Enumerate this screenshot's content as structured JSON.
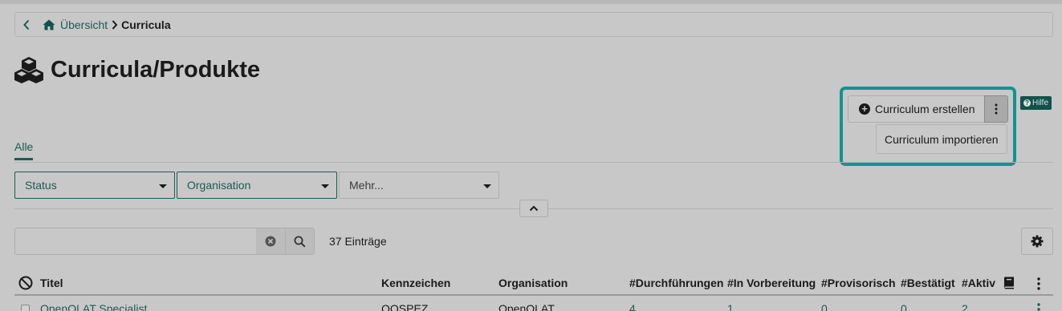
{
  "breadcrumb": {
    "home_label": "Übersicht",
    "current": "Curricula"
  },
  "page": {
    "title": "Curricula/Produkte"
  },
  "actions": {
    "create_label": "Curriculum erstellen",
    "menu_item_import": "Curriculum importieren",
    "help_label": "Hilfe"
  },
  "tabs": [
    {
      "label": "Alle",
      "active": true
    }
  ],
  "filters": [
    {
      "label": "Status",
      "active": true
    },
    {
      "label": "Organisation",
      "active": true
    },
    {
      "label": "Mehr...",
      "active": false
    }
  ],
  "search": {
    "placeholder": "",
    "value": ""
  },
  "results": {
    "count_label": "37 Einträge"
  },
  "table": {
    "columns": [
      "Titel",
      "Kennzeichen",
      "Organisation",
      "#Durchführungen",
      "#In Vorbereitung",
      "#Provisorisch",
      "#Bestätigt",
      "#Aktiv"
    ],
    "rows": [
      {
        "title": "OpenOLAT Specialist",
        "code": "OOSPEZ",
        "organisation": "OpenOLAT",
        "durchfuehrungen": "4",
        "vorbereitung": "1",
        "provisorisch": "0",
        "bestaetigt": "0",
        "aktiv": "2"
      }
    ]
  },
  "colors": {
    "accent": "#1d5a52",
    "highlight": "#0f9494",
    "background": "#c8c8c8"
  },
  "icons": {
    "back": "chevron-left-icon",
    "home": "home-icon",
    "separator": "chevron-right-icon",
    "title": "cubes-icon",
    "create": "plus-circle-icon",
    "more": "vertical-dots-icon",
    "help": "question-circle-icon",
    "clear": "clear-circle-icon",
    "search": "search-icon",
    "settings": "gear-icon",
    "select_all": "no-entry-icon",
    "column_book": "book-icon"
  }
}
